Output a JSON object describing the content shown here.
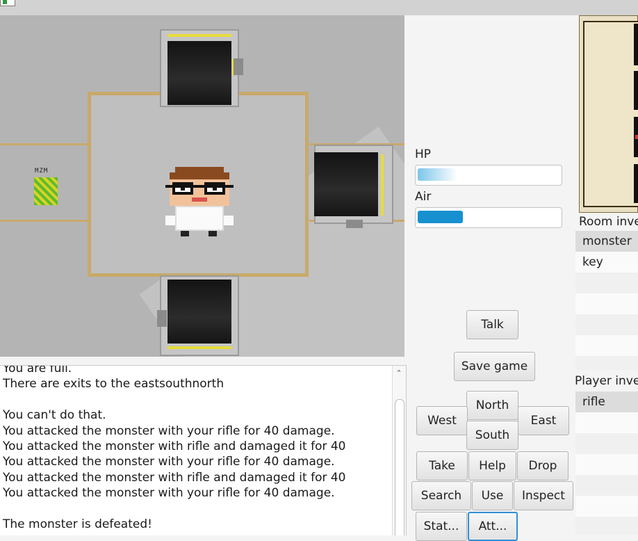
{
  "game": {
    "monster_text": "MZM"
  },
  "log": {
    "text": "You are full.\nThere are exits to the eastsouthnorth\n\nYou can't do that.\nYou attacked the monster with your rifle for 40 damage.\nYou attacked the monster with rifle and damaged it for 40\nYou attacked the monster with your rifle for 40 damage.\nYou attacked the monster with rifle and damaged it for 40\nYou attacked the monster with your rifle for 40 damage.\n\nThe monster is defeated!"
  },
  "status": {
    "hp_label": "HP",
    "hp_value": 0.28,
    "air_label": "Air",
    "air_value": 0.32,
    "hp_color": "#7cc6ea",
    "air_color": "#1790cf"
  },
  "buttons": {
    "talk": "Talk",
    "save": "Save game",
    "north": "North",
    "west": "West",
    "east": "East",
    "south": "South",
    "take": "Take",
    "help": "Help",
    "drop": "Drop",
    "search": "Search",
    "use": "Use",
    "inspect": "Inspect",
    "stat": "Stat...",
    "att": "Att..."
  },
  "room_inventory": {
    "header": "Room inve",
    "items": [
      "monster",
      "key"
    ]
  },
  "player_inventory": {
    "header": "Player inve",
    "items": [
      "rifle"
    ]
  }
}
